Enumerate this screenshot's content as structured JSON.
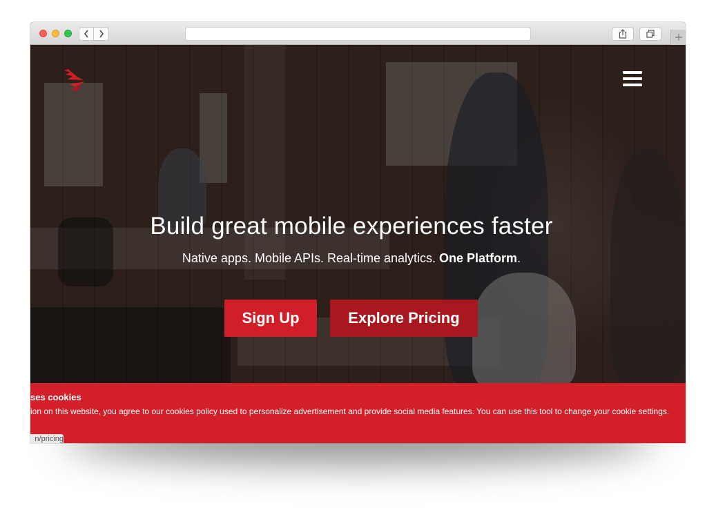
{
  "hero": {
    "headline": "Build great mobile experiences faster",
    "subline_text": "Native apps. Mobile APIs. Real-time analytics. ",
    "subline_bold": "One Platform",
    "subline_end": ".",
    "signup_label": "Sign Up",
    "pricing_label": "Explore Pricing"
  },
  "cookie": {
    "title": "ses cookies",
    "text": "ion on this website, you agree to our cookies policy used to personalize advertisement and provide social media features. You can use this tool to change your cookie settings.",
    "status_url": "n/pricing"
  },
  "icons": {
    "logo": "brand-logo-icon",
    "menu": "hamburger-menu-icon",
    "back": "chevron-left-icon",
    "forward": "chevron-right-icon",
    "share": "share-icon",
    "tabs": "tabs-icon",
    "new_tab": "plus-icon"
  },
  "colors": {
    "accent": "#d01f29",
    "accent_dark": "#a9181f",
    "cookie_bar": "#d21f2a"
  }
}
